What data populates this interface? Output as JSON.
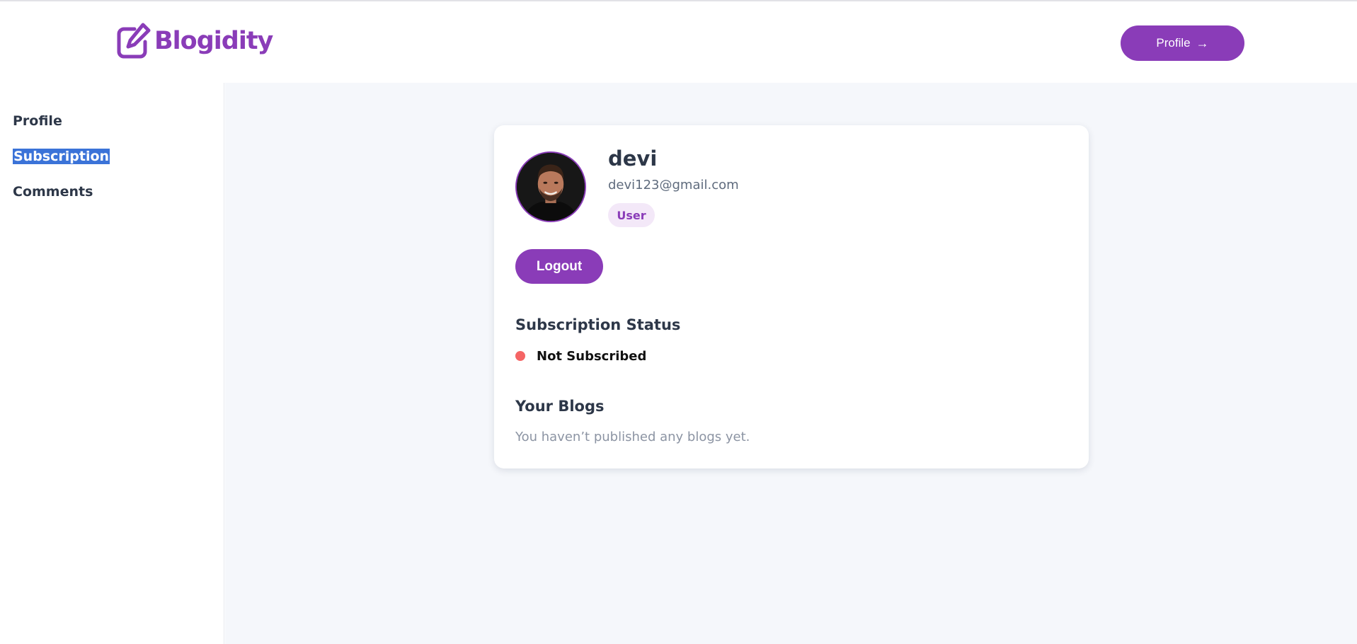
{
  "header": {
    "logo_text": "Blogidity",
    "profile_button": "Profile",
    "accent_color": "#8a3cb8"
  },
  "sidebar": {
    "items": [
      {
        "label": "Profile"
      },
      {
        "label": "Subscription",
        "selected": true
      },
      {
        "label": "Comments"
      }
    ]
  },
  "profile": {
    "username": "devi",
    "email": "devi123@gmail.com",
    "role": "User",
    "logout_label": "Logout",
    "avatar_icon": "user-photo"
  },
  "subscription": {
    "title": "Subscription Status",
    "status": "Not Subscribed",
    "status_color": "#f56565"
  },
  "blogs": {
    "title": "Your Blogs",
    "empty_message": "You haven’t published any blogs yet."
  }
}
